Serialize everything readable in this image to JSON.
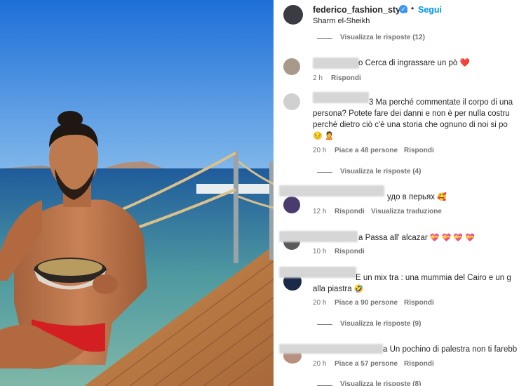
{
  "header": {
    "username": "federico_fashion_style",
    "follow_label": "Segui",
    "location": "Sharm el-Sheikh",
    "dot": "•"
  },
  "top_partial": {
    "view_replies": "Visualizza le risposte (12)"
  },
  "comments": [
    {
      "text_visible": "o Cerca di ingrassare un pò",
      "emoji": "❤️",
      "time": "2 h",
      "reply": "Rispondi"
    },
    {
      "line1": "3 Ma perché commentate il corpo di una",
      "line2": "persona? Potete fare dei danni e non è per nulla costru",
      "line3": "perché dietro ciò c'è una storia che ognuno di noi si po",
      "emoji_line": "😔 🙎",
      "time": "20 h",
      "likes": "Piace a 48 persone",
      "reply": "Rispondi",
      "view_replies": "Visualizza le risposte (4)"
    },
    {
      "text_visible": "удо в перьях",
      "emoji": "🥰",
      "time": "12 h",
      "reply": "Rispondi",
      "translate": "Visualizza traduzione"
    },
    {
      "text_visible": "a Passa all' alcazar",
      "emoji": "💝 💝 💝 💝",
      "time": "10 h",
      "reply": "Rispondi"
    },
    {
      "line1": "E un mix tra : una mummia del Cairo e un g",
      "line2": "alla piastra",
      "emoji": "🤣",
      "time": "20 h",
      "likes": "Piace a 90 persone",
      "reply": "Rispondi",
      "view_replies": "Visualizza le risposte (9)"
    },
    {
      "text_visible": "a Un pochino di palestra non ti farebb",
      "time": "20 h",
      "likes": "Piace a 57 persone",
      "reply": "Rispondi",
      "view_replies": "Visualizza le risposte (8)"
    }
  ],
  "colors": {
    "link": "#0095f6",
    "meta": "#737373",
    "text": "#262626",
    "heart": "#ed4956"
  },
  "icons": {
    "verified": "verified-badge-icon"
  }
}
